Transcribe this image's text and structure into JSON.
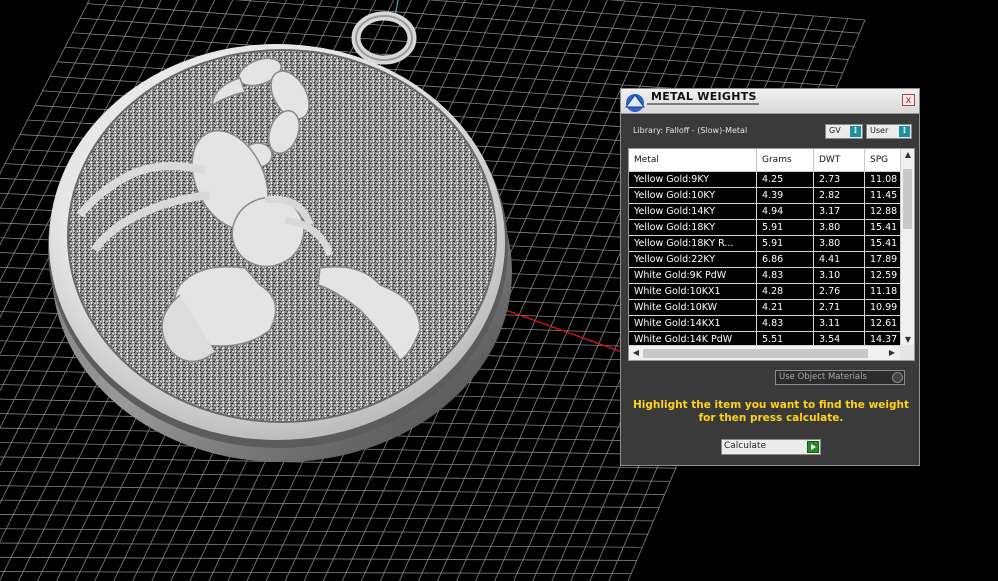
{
  "viewport": {
    "description_icon": "scorpion-pendant-model"
  },
  "dialog": {
    "title": "METAL WEIGHTS",
    "close_label": "x",
    "library_label": "Library: Falloff - (Slow)-Metal",
    "gv_select": "GV",
    "user_select": "User",
    "columns": [
      "Metal",
      "Grams",
      "DWT",
      "SPG"
    ],
    "rows": [
      {
        "metal": "Yellow Gold:9KY",
        "grams": "4.25",
        "dwt": "2.73",
        "spg": "11.08"
      },
      {
        "metal": "Yellow Gold:10KY",
        "grams": "4.39",
        "dwt": "2.82",
        "spg": "11.45"
      },
      {
        "metal": "Yellow Gold:14KY",
        "grams": "4.94",
        "dwt": "3.17",
        "spg": "12.88"
      },
      {
        "metal": "Yellow Gold:18KY",
        "grams": "5.91",
        "dwt": "3.80",
        "spg": "15.41"
      },
      {
        "metal": "Yellow Gold:18KY R...",
        "grams": "5.91",
        "dwt": "3.80",
        "spg": "15.41"
      },
      {
        "metal": "Yellow Gold:22KY",
        "grams": "6.86",
        "dwt": "4.41",
        "spg": "17.89"
      },
      {
        "metal": "White Gold:9K PdW",
        "grams": "4.83",
        "dwt": "3.10",
        "spg": "12.59"
      },
      {
        "metal": "White Gold:10KX1",
        "grams": "4.28",
        "dwt": "2.76",
        "spg": "11.18"
      },
      {
        "metal": "White Gold:10KW",
        "grams": "4.21",
        "dwt": "2.71",
        "spg": "10.99"
      },
      {
        "metal": "White Gold:14KX1",
        "grams": "4.83",
        "dwt": "3.11",
        "spg": "12.61"
      },
      {
        "metal": "White Gold:14K PdW",
        "grams": "5.51",
        "dwt": "3.54",
        "spg": "14.37"
      }
    ],
    "use_object_materials": "Use Object Materials",
    "hint": "Highlight the item you want to find the weight for then press calculate.",
    "calculate_label": "Calculate",
    "colors": {
      "hint": "#ffd21a",
      "row_bg": "#000000",
      "accent": "#1e8fa7"
    }
  }
}
